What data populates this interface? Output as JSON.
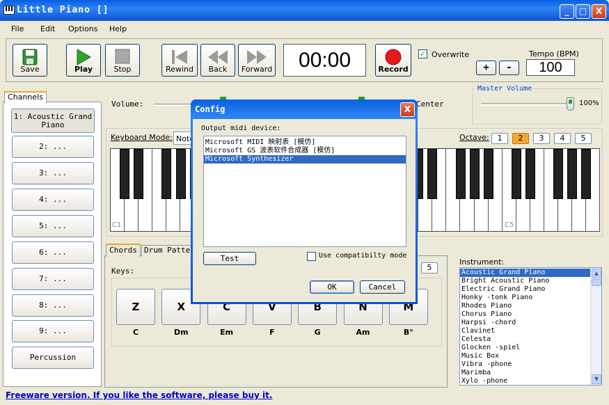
{
  "window": {
    "title": "Little Piano []",
    "minimize": "_",
    "maximize": "□",
    "close": "X"
  },
  "menu": [
    "File",
    "Edit",
    "Options",
    "Help"
  ],
  "toolbar": {
    "save": "Save",
    "play": "Play",
    "stop": "Stop",
    "rewind": "Rewind",
    "back": "Back",
    "forward": "Forward",
    "time": "00:00",
    "record": "Record",
    "overwrite": "Overwrite",
    "tempo_label": "Tempo (BPM)",
    "tempo_plus": "+",
    "tempo_minus": "-",
    "tempo_value": "100"
  },
  "channels": {
    "tab": "Channels",
    "items": [
      "1: Acoustic Grand Piano",
      "2: ...",
      "3: ...",
      "4: ...",
      "5: ...",
      "6: ...",
      "7: ...",
      "8: ...",
      "9: ...",
      "Percussion"
    ]
  },
  "controls": {
    "volume_label": "Volume:",
    "center_label": "Center",
    "master_label": "Master Volume",
    "master_value": "100%"
  },
  "keyboard": {
    "mode_label": "Keyboard Mode:",
    "mode_value": "Note",
    "octave_label": "Octave:",
    "octaves": [
      "1",
      "2",
      "3",
      "4",
      "5"
    ],
    "selected_octave": "2",
    "c1": "C1",
    "c5": "C5"
  },
  "chords": {
    "tab_chords": "Chords",
    "tab_drum": "Drum Patter",
    "keys_label": "Keys:",
    "page_btn": "5",
    "keys": [
      {
        "key": "Z",
        "chord": "C"
      },
      {
        "key": "X",
        "chord": "Dm"
      },
      {
        "key": "C",
        "chord": "Em"
      },
      {
        "key": "V",
        "chord": "F"
      },
      {
        "key": "B",
        "chord": "G"
      },
      {
        "key": "N",
        "chord": "Am"
      },
      {
        "key": "M",
        "chord": "B°"
      }
    ]
  },
  "instrument": {
    "label": "Instrument:",
    "items": [
      "Acoustic Grand Piano",
      "Bright Acoustic Piano",
      "Electric Grand Piano",
      "Honky -tonk Piano",
      "Rhodes Piano",
      "Chorus Piano",
      "Harpsi -chord",
      "Clavinet",
      "Celesta",
      "Glocken -spiel",
      "Music Box",
      "Vibra -phone",
      "Marimba",
      "Xylo -phone"
    ]
  },
  "dialog": {
    "title": "Config",
    "close": "X",
    "output_label": "Output midi device:",
    "devices": [
      "Microsoft MIDI 映射表 [模仿]",
      "Microsoft GS 波表软件合成器 [模仿]",
      "Microsoft Synthesizer"
    ],
    "test": "Test",
    "compat": "Use compatibilty mode",
    "ok": "OK",
    "cancel": "Cancel"
  },
  "status": "Freeware version. If you like the software, please buy it."
}
